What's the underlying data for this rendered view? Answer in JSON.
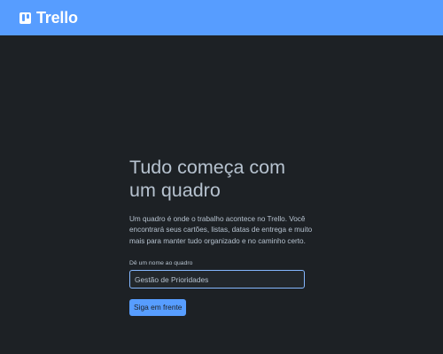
{
  "header": {
    "brand": "Trello",
    "logo_icon": "trello-board-icon",
    "background": "#579dff"
  },
  "main": {
    "title": "Tudo começa com um quadro",
    "description": "Um quadro é onde o trabalho acontece no Trello. Você encontrará seus cartões, listas, datas de entrega e muito mais para manter tudo organizado e no caminho certo.",
    "board_name_label": "Dê um nome ao quadro",
    "board_name_value": "Gestão de Prioridades",
    "continue_label": "Siga em frente"
  },
  "colors": {
    "page_background": "#1d2125",
    "text": "#b6c2cf",
    "accent": "#579dff"
  }
}
